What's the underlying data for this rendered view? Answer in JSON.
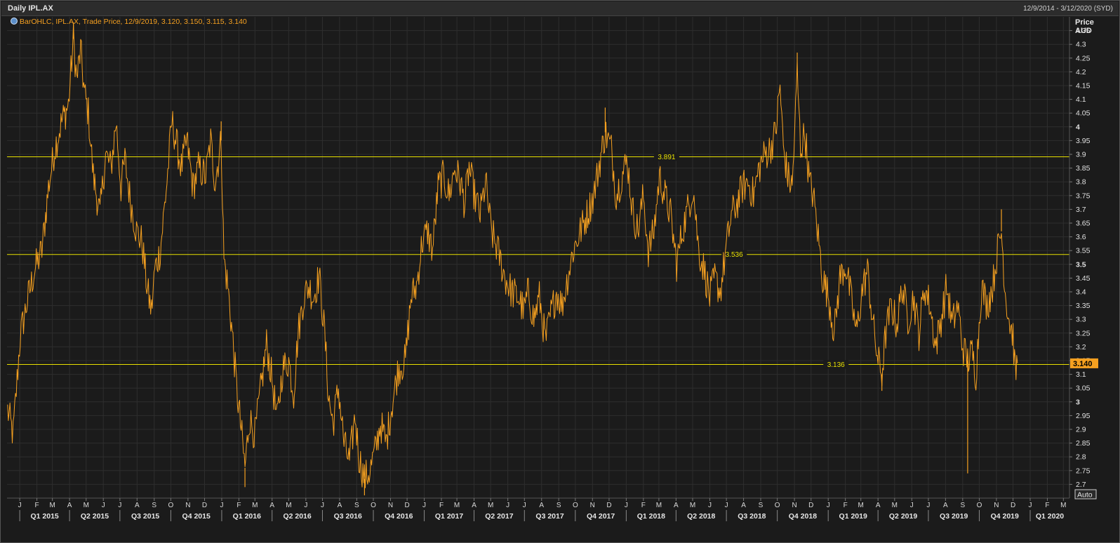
{
  "window": {
    "title": "Daily IPL.AX",
    "date_range": "12/9/2014 - 3/12/2020 (SYD)"
  },
  "legend": {
    "text": "BarOHLC, IPL.AX, Trade Price, 12/9/2019, 3.120, 3.150, 3.115, 3.140"
  },
  "axis": {
    "price_label": "Price",
    "currency_label": "AUD",
    "auto_button": "Auto",
    "last_price_label": "3.140"
  },
  "colors": {
    "series": "#f5a020",
    "hline": "#e8e000",
    "background": "#1b1b1b",
    "grid": "#2e2e2e"
  },
  "chart_data": {
    "type": "line",
    "title": "Daily IPL.AX",
    "series_name": "IPL.AX Trade Price",
    "x_range": [
      "2014-12-09",
      "2020-03-12"
    ],
    "ylim": [
      2.65,
      4.4
    ],
    "y_ticks": [
      2.7,
      2.75,
      2.8,
      2.85,
      2.9,
      2.95,
      3,
      3.05,
      3.1,
      3.15,
      3.2,
      3.25,
      3.3,
      3.35,
      3.4,
      3.45,
      3.5,
      3.55,
      3.6,
      3.65,
      3.7,
      3.75,
      3.8,
      3.85,
      3.9,
      3.95,
      4,
      4.05,
      4.1,
      4.15,
      4.2,
      4.25,
      4.3,
      4.35
    ],
    "y_tick_labels": [
      "2.7",
      "2.75",
      "2.8",
      "2.85",
      "2.9",
      "2.95",
      "3",
      "3.05",
      "3.1",
      "3.15",
      "3.2",
      "3.25",
      "3.3",
      "3.35",
      "3.4",
      "3.45",
      "3.5",
      "3.55",
      "3.6",
      "3.65",
      "3.7",
      "3.75",
      "3.8",
      "3.85",
      "3.9",
      "3.95",
      "4",
      "4.05",
      "4.1",
      "4.15",
      "4.2",
      "4.25",
      "4.3",
      "4.35"
    ],
    "y_bold_ticks": [
      3,
      3.5,
      4
    ],
    "last_price": 3.14,
    "horizontal_lines": [
      {
        "value": 3.891,
        "label": "3.891",
        "label_date": "2018-03-15"
      },
      {
        "value": 3.536,
        "label": "3.536",
        "label_date": "2018-07-15"
      },
      {
        "value": 3.136,
        "label": "3.136",
        "label_date": "2019-01-15"
      }
    ],
    "month_ticks": [
      {
        "label": "J",
        "date": "2015-01-01"
      },
      {
        "label": "F",
        "date": "2015-02-01"
      },
      {
        "label": "M",
        "date": "2015-03-01"
      },
      {
        "label": "A",
        "date": "2015-04-01"
      },
      {
        "label": "M",
        "date": "2015-05-01"
      },
      {
        "label": "J",
        "date": "2015-06-01"
      },
      {
        "label": "J",
        "date": "2015-07-01"
      },
      {
        "label": "A",
        "date": "2015-08-01"
      },
      {
        "label": "S",
        "date": "2015-09-01"
      },
      {
        "label": "O",
        "date": "2015-10-01"
      },
      {
        "label": "N",
        "date": "2015-11-01"
      },
      {
        "label": "D",
        "date": "2015-12-01"
      },
      {
        "label": "J",
        "date": "2016-01-01"
      },
      {
        "label": "F",
        "date": "2016-02-01"
      },
      {
        "label": "M",
        "date": "2016-03-01"
      },
      {
        "label": "A",
        "date": "2016-04-01"
      },
      {
        "label": "M",
        "date": "2016-05-01"
      },
      {
        "label": "J",
        "date": "2016-06-01"
      },
      {
        "label": "J",
        "date": "2016-07-01"
      },
      {
        "label": "A",
        "date": "2016-08-01"
      },
      {
        "label": "S",
        "date": "2016-09-01"
      },
      {
        "label": "O",
        "date": "2016-10-01"
      },
      {
        "label": "N",
        "date": "2016-11-01"
      },
      {
        "label": "D",
        "date": "2016-12-01"
      },
      {
        "label": "J",
        "date": "2017-01-01"
      },
      {
        "label": "F",
        "date": "2017-02-01"
      },
      {
        "label": "M",
        "date": "2017-03-01"
      },
      {
        "label": "A",
        "date": "2017-04-01"
      },
      {
        "label": "M",
        "date": "2017-05-01"
      },
      {
        "label": "J",
        "date": "2017-06-01"
      },
      {
        "label": "J",
        "date": "2017-07-01"
      },
      {
        "label": "A",
        "date": "2017-08-01"
      },
      {
        "label": "S",
        "date": "2017-09-01"
      },
      {
        "label": "O",
        "date": "2017-10-01"
      },
      {
        "label": "N",
        "date": "2017-11-01"
      },
      {
        "label": "D",
        "date": "2017-12-01"
      },
      {
        "label": "J",
        "date": "2018-01-01"
      },
      {
        "label": "F",
        "date": "2018-02-01"
      },
      {
        "label": "M",
        "date": "2018-03-01"
      },
      {
        "label": "A",
        "date": "2018-04-01"
      },
      {
        "label": "M",
        "date": "2018-05-01"
      },
      {
        "label": "J",
        "date": "2018-06-01"
      },
      {
        "label": "J",
        "date": "2018-07-01"
      },
      {
        "label": "A",
        "date": "2018-08-01"
      },
      {
        "label": "S",
        "date": "2018-09-01"
      },
      {
        "label": "O",
        "date": "2018-10-01"
      },
      {
        "label": "N",
        "date": "2018-11-01"
      },
      {
        "label": "D",
        "date": "2018-12-01"
      },
      {
        "label": "J",
        "date": "2019-01-01"
      },
      {
        "label": "F",
        "date": "2019-02-01"
      },
      {
        "label": "M",
        "date": "2019-03-01"
      },
      {
        "label": "A",
        "date": "2019-04-01"
      },
      {
        "label": "M",
        "date": "2019-05-01"
      },
      {
        "label": "J",
        "date": "2019-06-01"
      },
      {
        "label": "J",
        "date": "2019-07-01"
      },
      {
        "label": "A",
        "date": "2019-08-01"
      },
      {
        "label": "S",
        "date": "2019-09-01"
      },
      {
        "label": "O",
        "date": "2019-10-01"
      },
      {
        "label": "N",
        "date": "2019-11-01"
      },
      {
        "label": "D",
        "date": "2019-12-01"
      },
      {
        "label": "J",
        "date": "2020-01-01"
      },
      {
        "label": "F",
        "date": "2020-02-01"
      },
      {
        "label": "M",
        "date": "2020-03-01"
      }
    ],
    "quarter_labels": [
      {
        "label": "Q1 2015",
        "start": "2015-01-01",
        "end": "2015-04-01"
      },
      {
        "label": "Q2 2015",
        "start": "2015-04-01",
        "end": "2015-07-01"
      },
      {
        "label": "Q3 2015",
        "start": "2015-07-01",
        "end": "2015-10-01"
      },
      {
        "label": "Q4 2015",
        "start": "2015-10-01",
        "end": "2016-01-01"
      },
      {
        "label": "Q1 2016",
        "start": "2016-01-01",
        "end": "2016-04-01"
      },
      {
        "label": "Q2 2016",
        "start": "2016-04-01",
        "end": "2016-07-01"
      },
      {
        "label": "Q3 2016",
        "start": "2016-07-01",
        "end": "2016-10-01"
      },
      {
        "label": "Q4 2016",
        "start": "2016-10-01",
        "end": "2017-01-01"
      },
      {
        "label": "Q1 2017",
        "start": "2017-01-01",
        "end": "2017-04-01"
      },
      {
        "label": "Q2 2017",
        "start": "2017-04-01",
        "end": "2017-07-01"
      },
      {
        "label": "Q3 2017",
        "start": "2017-07-01",
        "end": "2017-10-01"
      },
      {
        "label": "Q4 2017",
        "start": "2017-10-01",
        "end": "2018-01-01"
      },
      {
        "label": "Q1 2018",
        "start": "2018-01-01",
        "end": "2018-04-01"
      },
      {
        "label": "Q2 2018",
        "start": "2018-04-01",
        "end": "2018-07-01"
      },
      {
        "label": "Q3 2018",
        "start": "2018-07-01",
        "end": "2018-10-01"
      },
      {
        "label": "Q4 2018",
        "start": "2018-10-01",
        "end": "2019-01-01"
      },
      {
        "label": "Q1 2019",
        "start": "2019-01-01",
        "end": "2019-04-01"
      },
      {
        "label": "Q2 2019",
        "start": "2019-04-01",
        "end": "2019-07-01"
      },
      {
        "label": "Q3 2019",
        "start": "2019-07-01",
        "end": "2019-10-01"
      },
      {
        "label": "Q4 2019",
        "start": "2019-10-01",
        "end": "2020-01-01"
      },
      {
        "label": "Q1 2020",
        "start": "2020-01-01",
        "end": "2020-04-01"
      }
    ],
    "price_points": [
      [
        "2014-12-10",
        2.97
      ],
      [
        "2014-12-20",
        2.88
      ],
      [
        "2015-01-02",
        3.24
      ],
      [
        "2015-01-15",
        3.37
      ],
      [
        "2015-01-28",
        3.48
      ],
      [
        "2015-02-10",
        3.55
      ],
      [
        "2015-02-22",
        3.78
      ],
      [
        "2015-03-05",
        3.92
      ],
      [
        "2015-03-18",
        4.02
      ],
      [
        "2015-03-30",
        4.08
      ],
      [
        "2015-04-08",
        4.32
      ],
      [
        "2015-04-14",
        4.17
      ],
      [
        "2015-04-21",
        4.28
      ],
      [
        "2015-04-28",
        4.12
      ],
      [
        "2015-05-05",
        4.05
      ],
      [
        "2015-05-14",
        3.82
      ],
      [
        "2015-05-26",
        3.68
      ],
      [
        "2015-06-05",
        3.9
      ],
      [
        "2015-06-15",
        3.85
      ],
      [
        "2015-06-24",
        4.02
      ],
      [
        "2015-07-03",
        3.78
      ],
      [
        "2015-07-10",
        3.88
      ],
      [
        "2015-07-20",
        3.73
      ],
      [
        "2015-07-31",
        3.62
      ],
      [
        "2015-08-10",
        3.58
      ],
      [
        "2015-08-20",
        3.4
      ],
      [
        "2015-08-27",
        3.33
      ],
      [
        "2015-09-02",
        3.48
      ],
      [
        "2015-09-12",
        3.55
      ],
      [
        "2015-09-24",
        3.8
      ],
      [
        "2015-10-03",
        4.02
      ],
      [
        "2015-10-10",
        3.95
      ],
      [
        "2015-10-20",
        3.85
      ],
      [
        "2015-10-30",
        3.95
      ],
      [
        "2015-11-10",
        3.78
      ],
      [
        "2015-11-20",
        3.85
      ],
      [
        "2015-12-03",
        3.82
      ],
      [
        "2015-12-12",
        3.95
      ],
      [
        "2015-12-20",
        3.8
      ],
      [
        "2015-12-31",
        3.95
      ],
      [
        "2016-01-05",
        3.52
      ],
      [
        "2016-01-12",
        3.42
      ],
      [
        "2016-01-20",
        3.25
      ],
      [
        "2016-01-28",
        3.05
      ],
      [
        "2016-02-05",
        2.9
      ],
      [
        "2016-02-12",
        2.76
      ],
      [
        "2016-02-20",
        2.94
      ],
      [
        "2016-03-01",
        2.88
      ],
      [
        "2016-03-10",
        3.02
      ],
      [
        "2016-03-22",
        3.21
      ],
      [
        "2016-04-01",
        3.08
      ],
      [
        "2016-04-10",
        2.93
      ],
      [
        "2016-04-20",
        3.12
      ],
      [
        "2016-05-01",
        3.15
      ],
      [
        "2016-05-10",
        3.03
      ],
      [
        "2016-05-18",
        3.25
      ],
      [
        "2016-05-28",
        3.38
      ],
      [
        "2016-06-06",
        3.42
      ],
      [
        "2016-06-15",
        3.38
      ],
      [
        "2016-06-25",
        3.46
      ],
      [
        "2016-07-05",
        3.25
      ],
      [
        "2016-07-12",
        3.02
      ],
      [
        "2016-07-20",
        2.92
      ],
      [
        "2016-07-30",
        3.05
      ],
      [
        "2016-08-09",
        2.85
      ],
      [
        "2016-08-19",
        2.78
      ],
      [
        "2016-08-29",
        2.95
      ],
      [
        "2016-09-05",
        2.8
      ],
      [
        "2016-09-15",
        2.72
      ],
      [
        "2016-09-25",
        2.75
      ],
      [
        "2016-10-04",
        2.82
      ],
      [
        "2016-10-14",
        2.92
      ],
      [
        "2016-10-24",
        2.85
      ],
      [
        "2016-11-03",
        2.98
      ],
      [
        "2016-11-15",
        3.12
      ],
      [
        "2016-11-28",
        3.15
      ],
      [
        "2016-12-08",
        3.38
      ],
      [
        "2016-12-18",
        3.42
      ],
      [
        "2016-12-28",
        3.58
      ],
      [
        "2017-01-07",
        3.62
      ],
      [
        "2017-01-16",
        3.55
      ],
      [
        "2017-01-26",
        3.78
      ],
      [
        "2017-02-05",
        3.82
      ],
      [
        "2017-02-15",
        3.75
      ],
      [
        "2017-02-25",
        3.85
      ],
      [
        "2017-03-07",
        3.8
      ],
      [
        "2017-03-15",
        3.72
      ],
      [
        "2017-03-23",
        3.85
      ],
      [
        "2017-04-02",
        3.75
      ],
      [
        "2017-04-12",
        3.68
      ],
      [
        "2017-04-22",
        3.8
      ],
      [
        "2017-05-02",
        3.62
      ],
      [
        "2017-05-14",
        3.55
      ],
      [
        "2017-05-27",
        3.45
      ],
      [
        "2017-06-08",
        3.4
      ],
      [
        "2017-06-20",
        3.38
      ],
      [
        "2017-06-30",
        3.33
      ],
      [
        "2017-07-08",
        3.4
      ],
      [
        "2017-07-18",
        3.3
      ],
      [
        "2017-07-28",
        3.38
      ],
      [
        "2017-08-08",
        3.22
      ],
      [
        "2017-08-18",
        3.32
      ],
      [
        "2017-08-28",
        3.4
      ],
      [
        "2017-09-07",
        3.35
      ],
      [
        "2017-09-17",
        3.45
      ],
      [
        "2017-09-27",
        3.55
      ],
      [
        "2017-10-10",
        3.62
      ],
      [
        "2017-10-22",
        3.68
      ],
      [
        "2017-11-03",
        3.75
      ],
      [
        "2017-11-12",
        3.85
      ],
      [
        "2017-11-24",
        3.98
      ],
      [
        "2017-12-05",
        3.92
      ],
      [
        "2017-12-14",
        3.75
      ],
      [
        "2017-12-24",
        3.82
      ],
      [
        "2018-01-03",
        3.88
      ],
      [
        "2018-01-12",
        3.7
      ],
      [
        "2018-01-22",
        3.62
      ],
      [
        "2018-02-01",
        3.75
      ],
      [
        "2018-02-10",
        3.55
      ],
      [
        "2018-02-20",
        3.62
      ],
      [
        "2018-03-02",
        3.82
      ],
      [
        "2018-03-12",
        3.75
      ],
      [
        "2018-03-22",
        3.68
      ],
      [
        "2018-04-02",
        3.5
      ],
      [
        "2018-04-12",
        3.62
      ],
      [
        "2018-04-22",
        3.7
      ],
      [
        "2018-05-02",
        3.78
      ],
      [
        "2018-05-12",
        3.55
      ],
      [
        "2018-05-22",
        3.48
      ],
      [
        "2018-06-01",
        3.38
      ],
      [
        "2018-06-10",
        3.45
      ],
      [
        "2018-06-20",
        3.4
      ],
      [
        "2018-06-30",
        3.55
      ],
      [
        "2018-07-10",
        3.68
      ],
      [
        "2018-07-20",
        3.72
      ],
      [
        "2018-07-30",
        3.78
      ],
      [
        "2018-08-09",
        3.8
      ],
      [
        "2018-08-19",
        3.75
      ],
      [
        "2018-08-29",
        3.85
      ],
      [
        "2018-09-08",
        3.9
      ],
      [
        "2018-09-18",
        3.92
      ],
      [
        "2018-09-28",
        3.98
      ],
      [
        "2018-10-06",
        4.15
      ],
      [
        "2018-10-12",
        3.92
      ],
      [
        "2018-10-20",
        3.82
      ],
      [
        "2018-10-28",
        3.78
      ],
      [
        "2018-11-06",
        4.2
      ],
      [
        "2018-11-12",
        3.92
      ],
      [
        "2018-11-20",
        3.98
      ],
      [
        "2018-11-28",
        3.8
      ],
      [
        "2018-12-05",
        3.75
      ],
      [
        "2018-12-14",
        3.6
      ],
      [
        "2018-12-22",
        3.45
      ],
      [
        "2019-01-02",
        3.38
      ],
      [
        "2019-01-12",
        3.25
      ],
      [
        "2019-01-22",
        3.45
      ],
      [
        "2019-02-01",
        3.5
      ],
      [
        "2019-02-11",
        3.38
      ],
      [
        "2019-02-21",
        3.25
      ],
      [
        "2019-03-03",
        3.4
      ],
      [
        "2019-03-13",
        3.48
      ],
      [
        "2019-03-23",
        3.28
      ],
      [
        "2019-04-01",
        3.15
      ],
      [
        "2019-04-08",
        3.1
      ],
      [
        "2019-04-15",
        3.25
      ],
      [
        "2019-04-25",
        3.35
      ],
      [
        "2019-05-05",
        3.28
      ],
      [
        "2019-05-15",
        3.42
      ],
      [
        "2019-05-25",
        3.3
      ],
      [
        "2019-06-04",
        3.38
      ],
      [
        "2019-06-14",
        3.25
      ],
      [
        "2019-06-24",
        3.42
      ],
      [
        "2019-07-04",
        3.35
      ],
      [
        "2019-07-14",
        3.2
      ],
      [
        "2019-07-24",
        3.3
      ],
      [
        "2019-08-03",
        3.42
      ],
      [
        "2019-08-13",
        3.28
      ],
      [
        "2019-08-23",
        3.35
      ],
      [
        "2019-09-01",
        3.2
      ],
      [
        "2019-09-10",
        3.15
      ],
      [
        "2019-09-18",
        3.18
      ],
      [
        "2019-09-25",
        3.1
      ],
      [
        "2019-10-05",
        3.42
      ],
      [
        "2019-10-15",
        3.35
      ],
      [
        "2019-10-25",
        3.42
      ],
      [
        "2019-11-03",
        3.55
      ],
      [
        "2019-11-10",
        3.62
      ],
      [
        "2019-11-17",
        3.4
      ],
      [
        "2019-11-24",
        3.3
      ],
      [
        "2019-12-01",
        3.24
      ],
      [
        "2019-12-05",
        3.1
      ],
      [
        "2019-12-09",
        3.14
      ]
    ],
    "spikes": [
      {
        "date": "2015-04-08",
        "high": 4.38
      },
      {
        "date": "2016-02-12",
        "low": 2.69
      },
      {
        "date": "2016-09-15",
        "low": 2.66
      },
      {
        "date": "2018-11-06",
        "high": 4.27
      },
      {
        "date": "2019-09-10",
        "low": 2.74
      },
      {
        "date": "2019-11-10",
        "high": 3.7
      },
      {
        "date": "2019-04-08",
        "low": 3.04
      },
      {
        "date": "2015-12-31",
        "high": 4.02
      },
      {
        "date": "2017-11-24",
        "high": 4.07
      }
    ]
  }
}
